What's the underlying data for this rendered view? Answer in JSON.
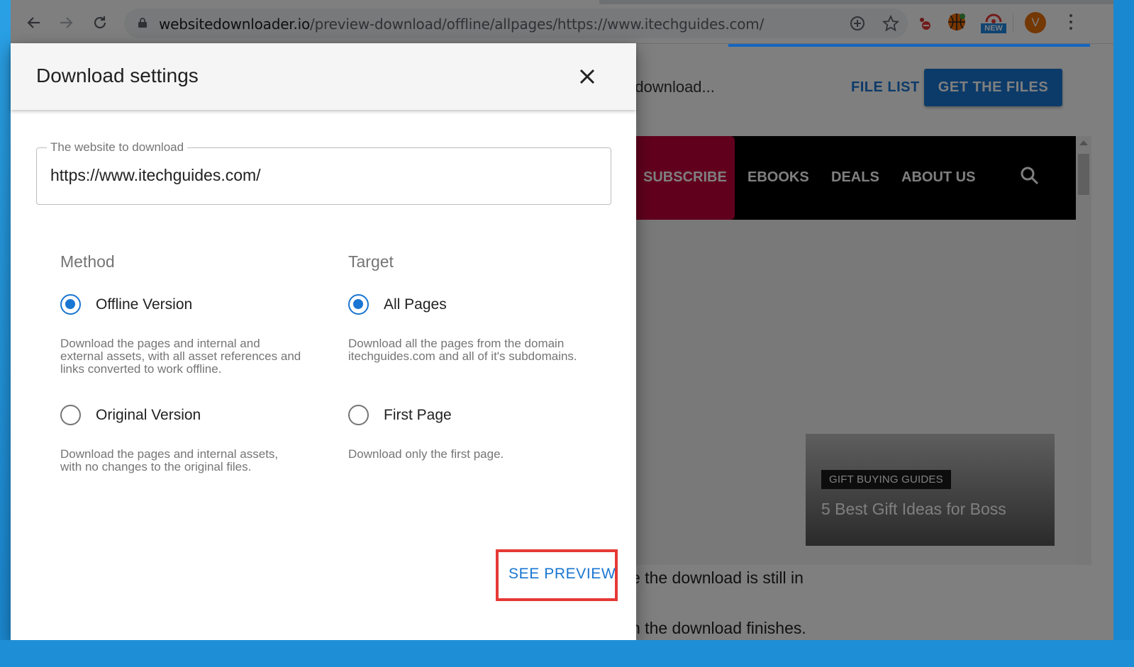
{
  "browser": {
    "url_domain": "websitedownloader.io",
    "url_path": "/preview-download/offline/allpages/https://www.itechguides.com/",
    "profile_initial": "V",
    "extension_badge": "NEW"
  },
  "background_page": {
    "header_text": "e download...",
    "file_list_label": "FILE LIST",
    "get_files_label": "GET THE FILES",
    "nav": [
      "SUBSCRIBE",
      "EBOOKS",
      "DEALS",
      "ABOUT US"
    ],
    "hero_badge": "GIFT BUYING GUIDES",
    "hero_title": "5 Best Gift Ideas for Boss",
    "line1": "e the download is still in",
    "line2": "n the download finishes."
  },
  "dialog": {
    "title": "Download settings",
    "field_label": "The website to download",
    "field_value": "https://www.itechguides.com/",
    "method": {
      "heading": "Method",
      "options": [
        {
          "label": "Offline Version",
          "desc": "Download the pages and internal and external assets, with all asset references and links converted to work offline.",
          "selected": true
        },
        {
          "label": "Original Version",
          "desc": "Download the pages and internal assets, with no changes to the original files.",
          "selected": false
        }
      ]
    },
    "target": {
      "heading": "Target",
      "options": [
        {
          "label": "All Pages",
          "desc": "Download all the pages from the domain itechguides.com and all of it's subdomains.",
          "selected": true
        },
        {
          "label": "First Page",
          "desc": "Download only the first page.",
          "selected": false
        }
      ]
    },
    "see_preview_label": "SEE PREVIEW"
  },
  "colors": {
    "accent": "#1976d2",
    "highlight": "#e53935",
    "subscribe": "#c2003a"
  }
}
